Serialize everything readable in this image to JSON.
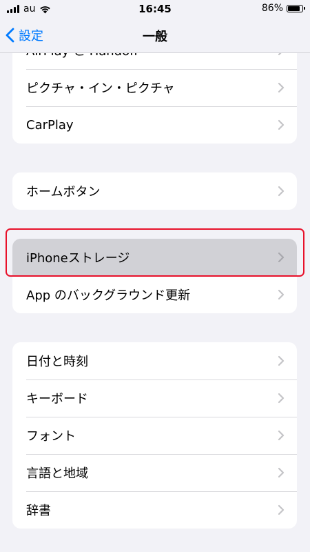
{
  "status_bar": {
    "carrier": "au",
    "time": "16:45",
    "battery_percent": "86%",
    "battery_level": 0.86
  },
  "nav": {
    "back_label": "設定",
    "title": "一般"
  },
  "groups": [
    {
      "items": [
        {
          "label": "AirPlay と Handoff"
        },
        {
          "label": "ピクチャ・イン・ピクチャ"
        },
        {
          "label": "CarPlay"
        }
      ]
    },
    {
      "items": [
        {
          "label": "ホームボタン"
        }
      ]
    },
    {
      "items": [
        {
          "label": "iPhoneストレージ",
          "selected": true
        },
        {
          "label": "App のバックグラウンド更新"
        }
      ]
    },
    {
      "items": [
        {
          "label": "日付と時刻"
        },
        {
          "label": "キーボード"
        },
        {
          "label": "フォント"
        },
        {
          "label": "言語と地域"
        },
        {
          "label": "辞書"
        }
      ]
    }
  ],
  "colors": {
    "accent": "#007aff",
    "highlight_outline": "#e8102a",
    "background": "#f2f2f7"
  }
}
